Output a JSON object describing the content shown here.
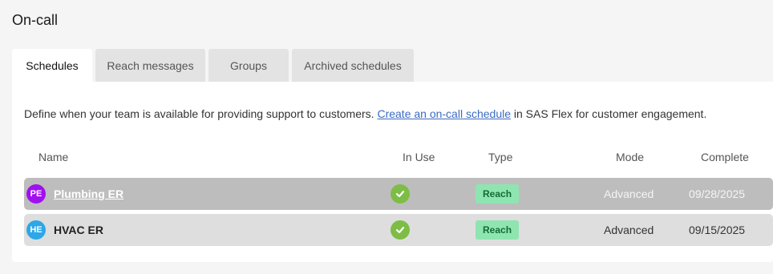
{
  "page": {
    "title": "On-call"
  },
  "tabs": [
    {
      "label": "Schedules",
      "active": true
    },
    {
      "label": "Reach messages",
      "active": false
    },
    {
      "label": "Groups",
      "active": false
    },
    {
      "label": "Archived schedules",
      "active": false
    }
  ],
  "description": {
    "before": "Define when your team is available for providing support to customers. ",
    "link": "Create an on-call schedule",
    "after": " in SAS Flex for customer engagement."
  },
  "table": {
    "columns": [
      "Name",
      "In Use",
      "Type",
      "Mode",
      "Complete"
    ],
    "rows": [
      {
        "initials": "PE",
        "avatar_color": "#a110f0",
        "name": "Plumbing ER",
        "in_use_icon": "check-circle-icon",
        "type": "Reach",
        "mode": "Advanced",
        "complete": "09/28/2025",
        "selected": true
      },
      {
        "initials": "HE",
        "avatar_color": "#2da7e8",
        "name": "HVAC ER",
        "in_use_icon": "check-circle-icon",
        "type": "Reach",
        "mode": "Advanced",
        "complete": "09/15/2025",
        "selected": false
      }
    ]
  },
  "colors": {
    "page_bg": "#f5f5f5",
    "accent_link": "#3b6bc4",
    "check_green": "#7dbd45",
    "reach_badge_bg": "#8ee5b0",
    "reach_badge_text": "#156b34",
    "selected_row_bg": "#bdbdbd",
    "row_bg": "#dedede"
  }
}
